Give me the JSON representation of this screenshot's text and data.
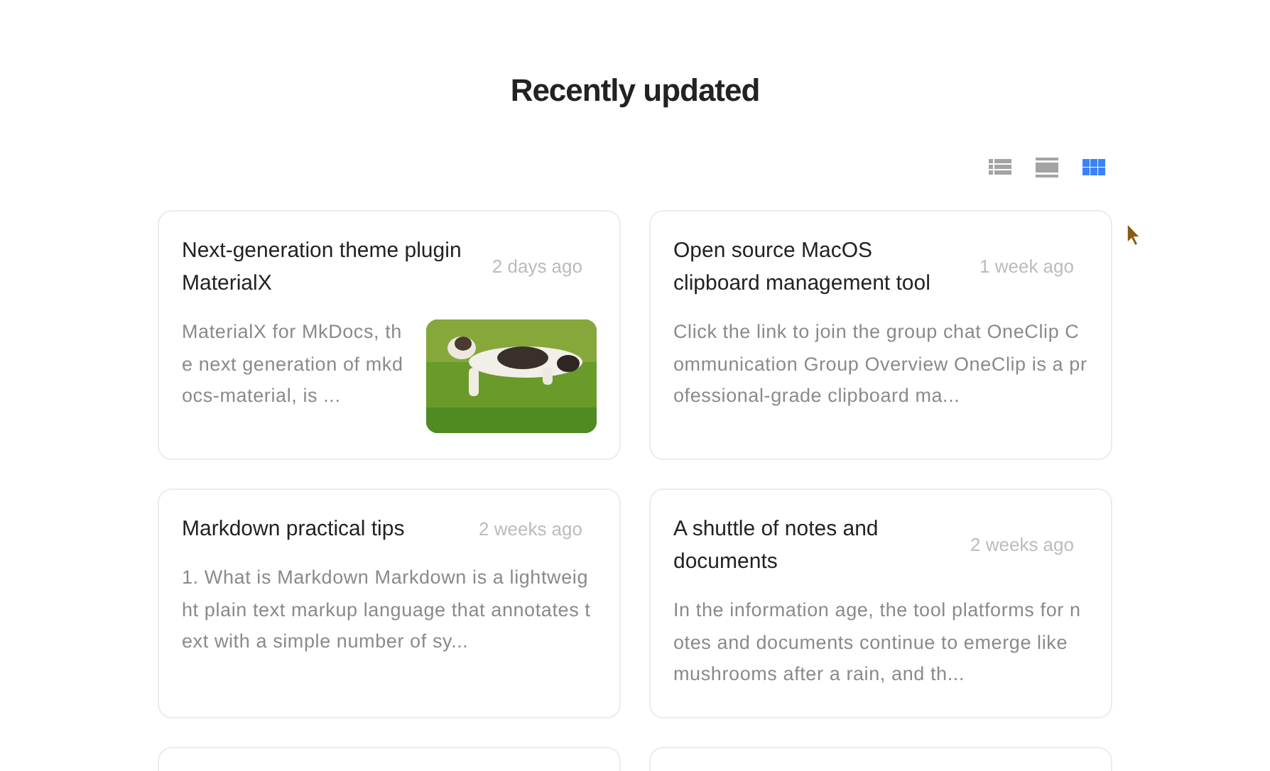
{
  "heading": "Recently updated",
  "views": [
    {
      "kind": "list",
      "selected": false
    },
    {
      "kind": "rows",
      "selected": false
    },
    {
      "kind": "grid",
      "selected": true
    }
  ],
  "posts": [
    {
      "kind": "post",
      "title": "Next-generation theme plugin MaterialX",
      "time": "2 days ago",
      "excerpt": "MaterialX for MkDocs, the next generation of mkdocs-material, is ..."
    },
    {
      "kind": "post",
      "title": "Open source MacOS clipboard management tool",
      "time": "1 week ago",
      "excerpt": "Click the link to join the group chat OneClip Communication Group Overview OneClip is a professional-grade clipboard ma..."
    },
    {
      "kind": "post",
      "title": "Markdown practical tips",
      "time": "2 weeks ago",
      "excerpt": "1. What is Markdown Markdown is a lightweight plain text markup language that annotates text with a simple number of sy..."
    },
    {
      "kind": "post",
      "title": "A shuttle of notes and documents",
      "time": "2 weeks ago",
      "excerpt": "In the information age, the tool platforms for notes and documents continue to emerge like mushrooms after a rain, and th..."
    },
    {
      "kind": "cutoff"
    },
    {
      "kind": "cutoff"
    }
  ]
}
